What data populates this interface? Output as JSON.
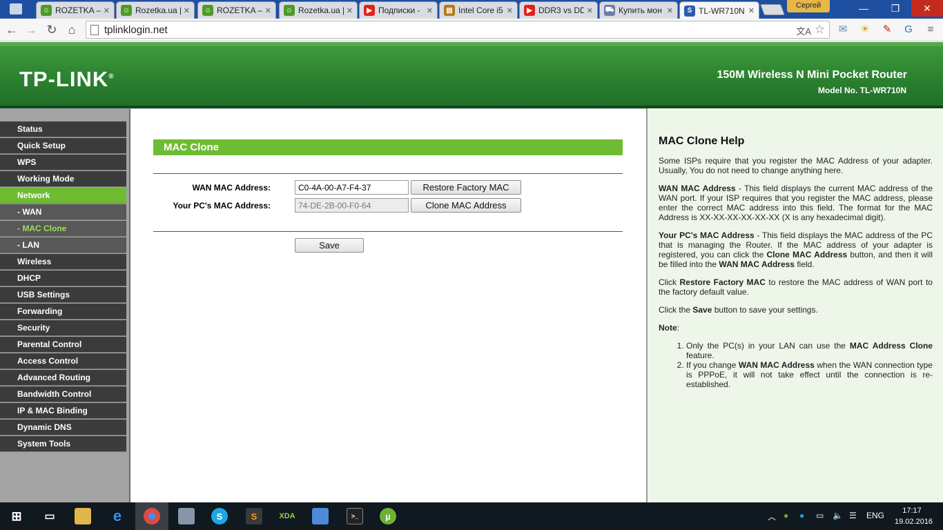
{
  "browser": {
    "tabs": [
      {
        "title": "ROZETKA —",
        "favicon": "rozetka-frog-icon",
        "color": "#4e9a28"
      },
      {
        "title": "Rozetka.ua |",
        "favicon": "rozetka-frog-icon",
        "color": "#4e9a28"
      },
      {
        "title": "ROZETKA —",
        "favicon": "rozetka-frog-icon",
        "color": "#4e9a28"
      },
      {
        "title": "Rozetka.ua |",
        "favicon": "rozetka-frog-icon",
        "color": "#4e9a28"
      },
      {
        "title": "Подписки -",
        "favicon": "youtube-icon",
        "color": "#e62117"
      },
      {
        "title": "Intel Core i5",
        "favicon": "folder-icon",
        "color": "#b07a1b"
      },
      {
        "title": "DDR3 vs DD",
        "favicon": "youtube-icon",
        "color": "#e62117"
      },
      {
        "title": "Купить мон",
        "favicon": "cart-icon",
        "color": "#6a7fa6"
      },
      {
        "title": "TL-WR710N",
        "favicon": "s-icon",
        "color": "#2a5db0"
      }
    ],
    "profile_name": "Сергей",
    "url": "tplinklogin.net"
  },
  "router": {
    "logo": "TP-LINK",
    "product_name": "150M Wireless N Mini Pocket Router",
    "model_no": "Model No. TL-WR710N"
  },
  "menu": [
    {
      "label": "Status"
    },
    {
      "label": "Quick Setup"
    },
    {
      "label": "WPS"
    },
    {
      "label": "Working Mode"
    },
    {
      "label": "Network"
    },
    {
      "label": "- WAN"
    },
    {
      "label": "- MAC Clone"
    },
    {
      "label": "- LAN"
    },
    {
      "label": "Wireless"
    },
    {
      "label": "DHCP"
    },
    {
      "label": "USB Settings"
    },
    {
      "label": "Forwarding"
    },
    {
      "label": "Security"
    },
    {
      "label": "Parental Control"
    },
    {
      "label": "Access Control"
    },
    {
      "label": "Advanced Routing"
    },
    {
      "label": "Bandwidth Control"
    },
    {
      "label": "IP & MAC Binding"
    },
    {
      "label": "Dynamic DNS"
    },
    {
      "label": "System Tools"
    }
  ],
  "main": {
    "section_title": "MAC Clone",
    "wan_mac_label": "WAN MAC Address:",
    "wan_mac_value": "C0-4A-00-A7-F4-37",
    "pc_mac_label": "Your PC's MAC Address:",
    "pc_mac_value": "74-DE-2B-00-F0-64",
    "restore_button": "Restore Factory MAC",
    "clone_button": "Clone MAC Address",
    "save_button": "Save"
  },
  "help": {
    "title": "MAC Clone Help",
    "intro": "Some ISPs require that you register the MAC Address of your adapter. Usually, You do not need to change anything here.",
    "wan_term": "WAN MAC Address",
    "wan_text": " - This field displays the current MAC address of the WAN port. If your ISP requires that you register the MAC address, please enter the correct MAC address into this field. The format for the MAC Address is XX-XX-XX-XX-XX-XX (X is any hexadecimal digit).",
    "pc_term": "Your PC's MAC Address",
    "pc_text_1": " - This field displays the MAC address of the PC that is managing the Router. If the MAC address of your adapter is registered, you can click the ",
    "pc_text_clone": "Clone MAC Address",
    "pc_text_2": " button, and then it will be filled into the ",
    "pc_text_wan": "WAN MAC Address",
    "pc_text_3": " field.",
    "restore_1": "Click ",
    "restore_term": "Restore Factory MAC",
    "restore_2": " to restore the MAC address of WAN port to the factory default value.",
    "save_1": "Click the ",
    "save_term": "Save",
    "save_2": " button to save your settings.",
    "note_label": "Note",
    "note_colon": ":",
    "note1_a": "Only the PC(s) in your LAN can use the ",
    "note1_term": "MAC Address Clone",
    "note1_b": " feature.",
    "note2_a": "If you change ",
    "note2_term": "WAN MAC Address",
    "note2_b": " when the WAN connection type is PPPoE, it will not take effect until the connection is re-established."
  },
  "taskbar": {
    "language": "ENG",
    "time": "17:17",
    "date": "19.02.2016"
  }
}
